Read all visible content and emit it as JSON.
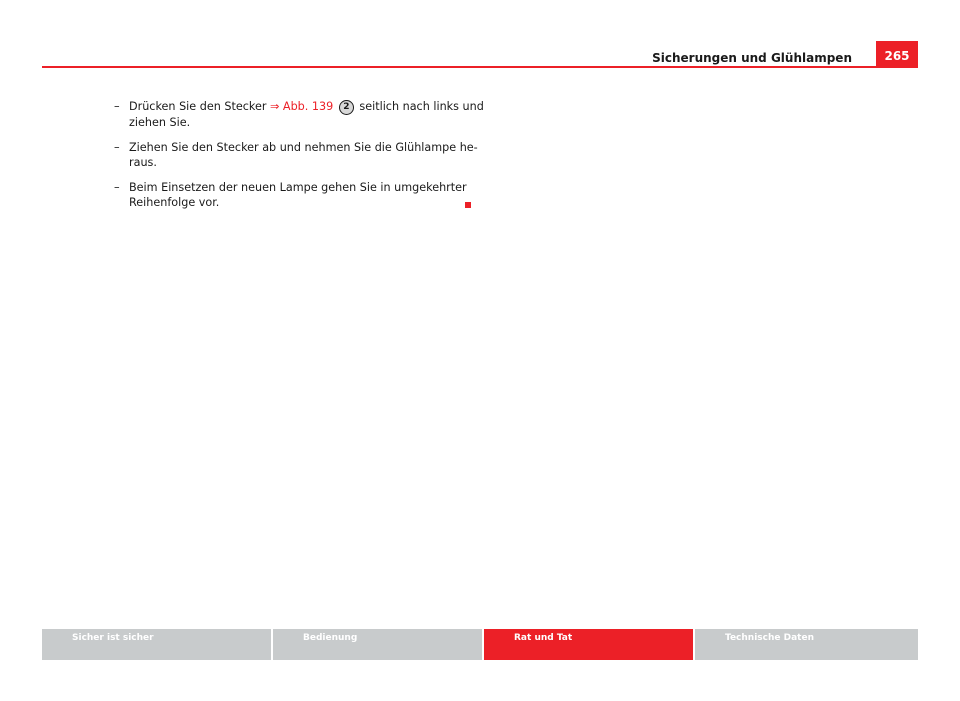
{
  "header": {
    "title": "Sicherungen und Glühlampen",
    "page_number": "265"
  },
  "steps": [
    {
      "dash": "–",
      "text_before": "Drücken Sie den Stecker ",
      "link": "⇒ Abb. 139",
      "badge": "2",
      "text_after": " seitlich nach links und ziehen Sie."
    },
    {
      "dash": "–",
      "text": "Ziehen Sie den Stecker ab und nehmen Sie die Glühlampe he-raus."
    },
    {
      "dash": "–",
      "text": "Beim Einsetzen der neuen Lampe gehen Sie in umgekehrter Reihenfolge vor."
    }
  ],
  "footer": {
    "tabs": [
      {
        "label": "Sicher ist sicher",
        "active": false
      },
      {
        "label": "Bedienung",
        "active": false
      },
      {
        "label": "Rat und Tat",
        "active": true
      },
      {
        "label": "Technische Daten",
        "active": false
      }
    ]
  },
  "colors": {
    "accent": "#ec2027",
    "tab_inactive": "#c8cbcc"
  }
}
